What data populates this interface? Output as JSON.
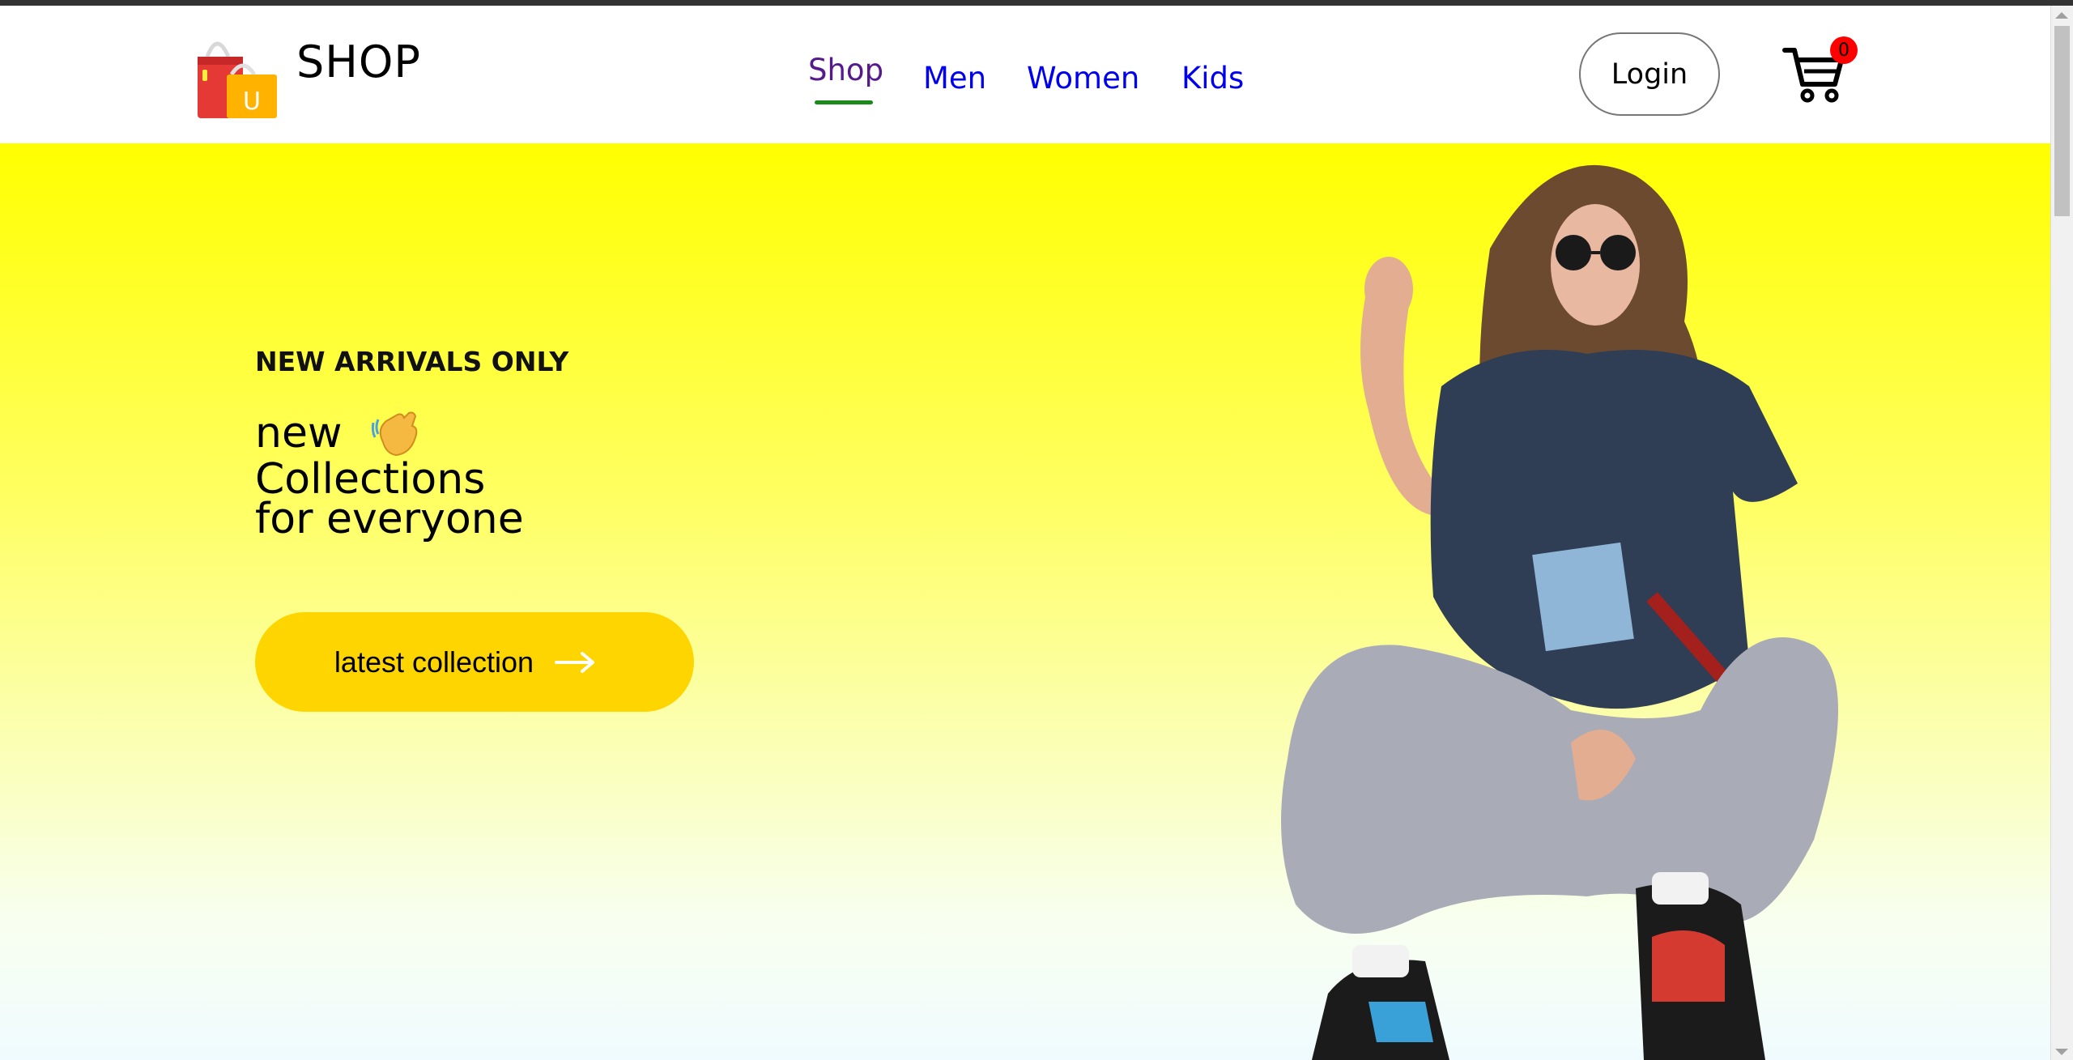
{
  "brand": {
    "name": "SHOP",
    "logo_icon": "shopping-bags-icon",
    "logo_letter": "U"
  },
  "nav": {
    "items": [
      {
        "label": "Shop",
        "active": true
      },
      {
        "label": "Men",
        "active": false
      },
      {
        "label": "Women",
        "active": false
      },
      {
        "label": "Kids",
        "active": false
      }
    ],
    "active_underline_color": "#1a8a1a",
    "link_color": "#0000ee",
    "visited_color": "#551a8b"
  },
  "header": {
    "login_label": "Login",
    "cart_count": "0",
    "cart_icon": "cart-icon"
  },
  "hero": {
    "eyebrow": "NEW ARRIVALS ONLY",
    "line1": "new",
    "line2": "Collections",
    "line3": "for everyone",
    "cta_label": "latest collection",
    "cta_color": "#ffd500",
    "background_top": "#ffff00"
  }
}
